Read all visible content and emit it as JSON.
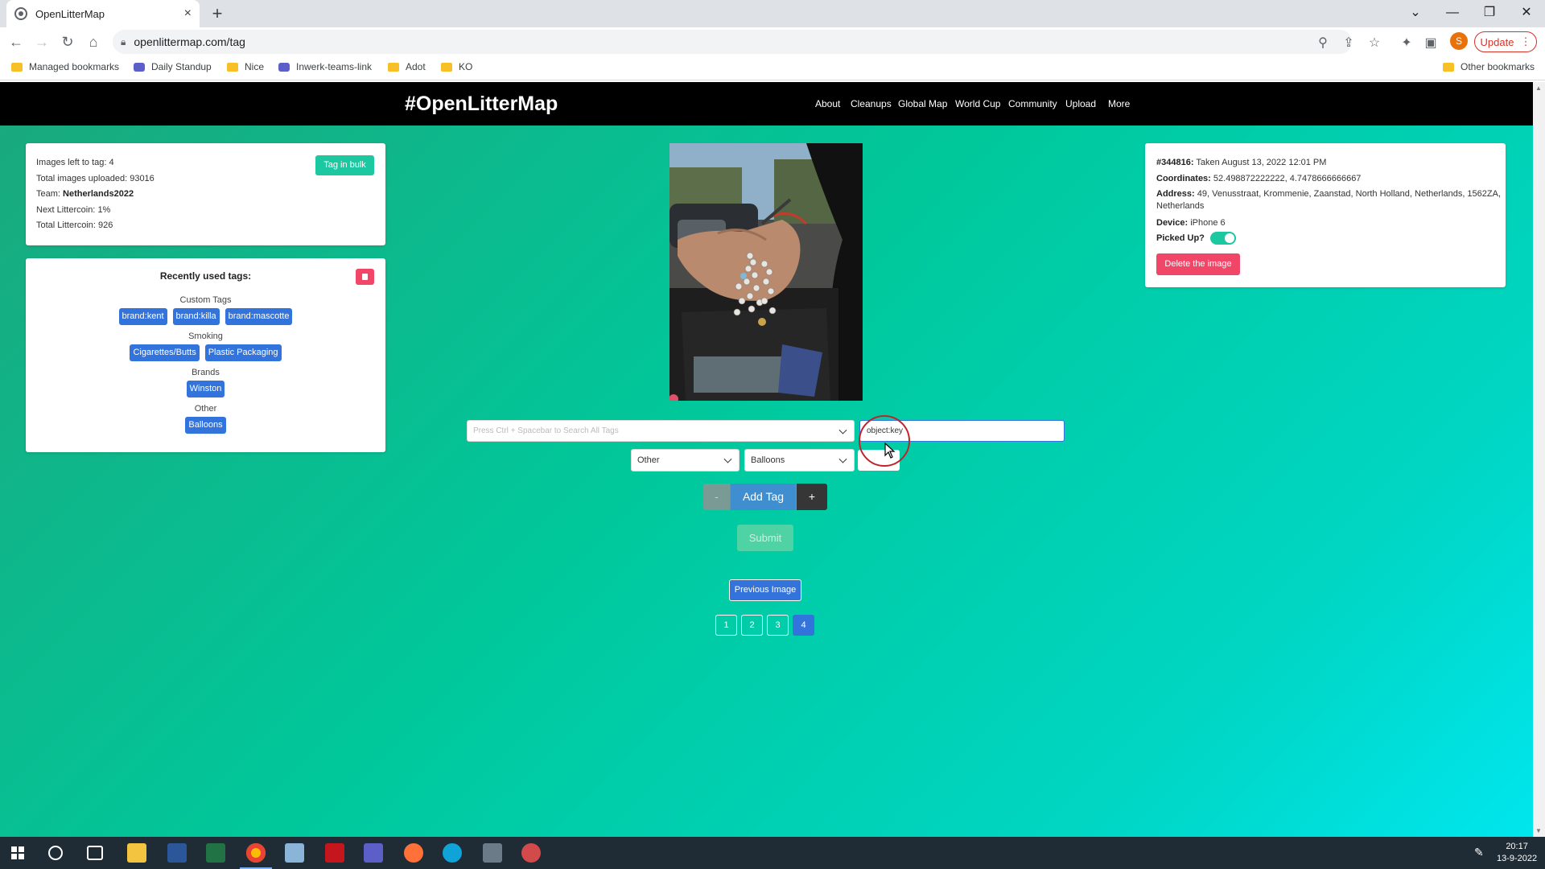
{
  "browser": {
    "tab_title": "OpenLitterMap",
    "tab_close": "×",
    "new_tab": "+",
    "url": "openlittermap.com/tag",
    "update_label": "Update",
    "avatar_letter": "S",
    "bookmarks": [
      {
        "label": "Managed bookmarks",
        "icon": "folder-icon"
      },
      {
        "label": "Daily Standup",
        "icon": "teams-icon"
      },
      {
        "label": "Nice",
        "icon": "folder-icon"
      },
      {
        "label": "Inwerk-teams-link",
        "icon": "teams-icon"
      },
      {
        "label": "Adot",
        "icon": "folder-icon"
      },
      {
        "label": "KO",
        "icon": "folder-icon"
      }
    ],
    "other_bookmarks": "Other bookmarks"
  },
  "site": {
    "logo": "#OpenLitterMap",
    "nav": [
      "About",
      "Cleanups",
      "Global Map",
      "World Cup",
      "Community",
      "Upload",
      "More"
    ]
  },
  "stats": {
    "images_left_label": "Images left to tag:",
    "images_left": "4",
    "total_uploaded_label": "Total images uploaded:",
    "total_uploaded": "93016",
    "team_label": "Team:",
    "team": "Netherlands2022",
    "next_littercoin_label": "Next Littercoin:",
    "next_littercoin": "1%",
    "total_littercoin_label": "Total Littercoin:",
    "total_littercoin": "926",
    "bulk_button": "Tag in bulk"
  },
  "recent_tags": {
    "title": "Recently used tags:",
    "groups": [
      {
        "label": "Custom Tags",
        "tags": [
          "brand:kent",
          "brand:killa",
          "brand:mascotte"
        ]
      },
      {
        "label": "Smoking",
        "tags": [
          "Cigarettes/Butts",
          "Plastic Packaging"
        ]
      },
      {
        "label": "Brands",
        "tags": [
          "Winston"
        ]
      },
      {
        "label": "Other",
        "tags": [
          "Balloons"
        ]
      }
    ]
  },
  "image_info": {
    "id": "#344816:",
    "taken": "Taken August 13, 2022 12:01 PM",
    "coordinates_label": "Coordinates:",
    "coordinates": "52.498872222222, 4.7478666666667",
    "address_label": "Address:",
    "address_line1": "49, Venusstraat, Krommenie, Zaanstad, North Holland, Netherlands, 1562ZA,",
    "address_line2": "Netherlands",
    "device_label": "Device:",
    "device": "iPhone 6",
    "picked_up_label": "Picked Up?",
    "picked_up": true,
    "delete_button": "Delete the image"
  },
  "tagging": {
    "search_placeholder": "Press Ctrl + Spacebar to Search All Tags",
    "custom_tag_value": "object:key",
    "category": "Other",
    "item": "Balloons",
    "minus": "-",
    "add_tag": "Add Tag",
    "plus": "+",
    "submit": "Submit",
    "previous": "Previous Image",
    "pages": [
      "1",
      "2",
      "3",
      "4"
    ],
    "current_page": "4"
  },
  "taskbar": {
    "time": "20:17",
    "date": "13-9-2022"
  },
  "colors": {
    "page_gradient_start": "#1aa87c",
    "page_gradient_end": "#00e6ee",
    "primary": "#3273dc",
    "danger": "#f14668",
    "success": "#1cc8a0"
  }
}
